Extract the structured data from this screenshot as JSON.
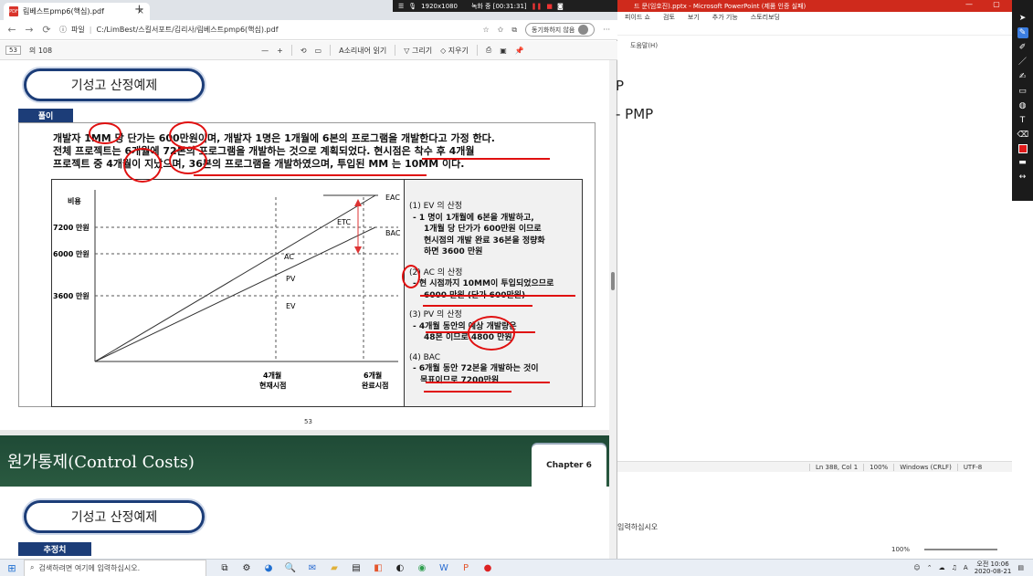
{
  "browser": {
    "tab_title": "림베스트pmp6(핵심).pdf",
    "tab_file_badge": "PDF",
    "nav_back": "←",
    "nav_forward": "→",
    "nav_refresh": "⟳",
    "url_prefix": "파일",
    "url": "C:/LimBest/스킬서포트/김리사/림베스트pmp6(핵심).pdf",
    "sync_label": "동기화하지 않음",
    "more": "···",
    "recording": {
      "resolution": "1920x1080",
      "status": "녹화 중 [00:31:31]"
    }
  },
  "pdf_toolbar": {
    "page_current": "53",
    "page_total": "의 108",
    "zoom_out": "—",
    "zoom_in": "+",
    "read_aloud": "소리내어 읽기",
    "draw": "그리기",
    "erase": "지우기"
  },
  "page53": {
    "section_title": "기성고 산정예제",
    "solution_label": "풀이",
    "problem_lines": [
      "개발자 1MM 당 단가는 600만원이며, 개발자 1명은 1개월에 6본의 프로그램을 개발한다고 가정 한다.",
      "전체 프로젝트는 6개월에 72본의 프로그램을 개발하는 것으로 계획되었다.  현시점은 착수 후 4개월",
      "프로젝트 중 4개월이 지났으며, 36본의 프로그램을 개발하였으며, 투입된 MM 는 10MM 이다."
    ],
    "figure": {
      "ylabel": "비용",
      "y_ticks": [
        "7200 만원",
        "6000 만원",
        "3600 만원"
      ],
      "series_labels": [
        "EAC",
        "ETC",
        "BAC",
        "AC",
        "PV",
        "EV"
      ],
      "x_labels": [
        {
          "line1": "4개월",
          "line2": "현재시점"
        },
        {
          "line1": "6개월",
          "line2": "완료시점"
        }
      ]
    },
    "explanation": {
      "ev_title": "(1) EV 의 산정",
      "ev_lines": [
        "- 1 명이 1개월에 6본을 개발하고,",
        "1개월 당 단가가 600만원 이므로",
        "현시점의 개발 완료 36본을 정량화",
        "하면 3600 만원"
      ],
      "ac_title": "(2) AC 의 산정",
      "ac_lines": [
        "- 현 시점까지 10MM이 투입되었으므로",
        "6000 만원 (단가 600만원)"
      ],
      "pv_title": "(3) PV 의 산정",
      "pv_lines": [
        "- 4개월 동안의 예상 개발량은",
        "48본 이므로 4800 만원"
      ],
      "bac_title": "(4) BAC",
      "bac_lines": [
        "- 6개월 동안 72본을 개발하는 것이",
        "목표이므로 7200만원"
      ]
    },
    "page_number": "53"
  },
  "page54": {
    "banner_title": "원가통제(Control Costs)",
    "chapter_badge": "Chapter 6",
    "section_title": "기성고 산정예제",
    "tab_label": "추정치"
  },
  "ppt": {
    "window_title": "드 문(임호진).pptx  -  Microsoft PowerPoint (제품 인증 실패)",
    "menu": [
      "피이드 쇼",
      "검토",
      "보기",
      "추가 기능",
      "스토리보딩"
    ],
    "notepad_menu": "도움말(H)",
    "text_line1": "P",
    "text_line2": "- PMP",
    "status": {
      "position": "Ln 388, Col 1",
      "zoom": "100%",
      "eol": "Windows (CRLF)",
      "encoding": "UTF-8"
    },
    "lower_prompt": "입력하십시오",
    "zoom_bottom": "100%"
  },
  "taskbar": {
    "search_placeholder": "검색하려면 여기에 입력하십시오.",
    "time": "오전 10:06",
    "date": "2020-08-21",
    "lang": "A"
  },
  "colors": {
    "navy": "#1c3d78",
    "red_annotation": "#e01010",
    "ppt_red": "#cf2a1c",
    "green_banner": "#1f4a36"
  }
}
